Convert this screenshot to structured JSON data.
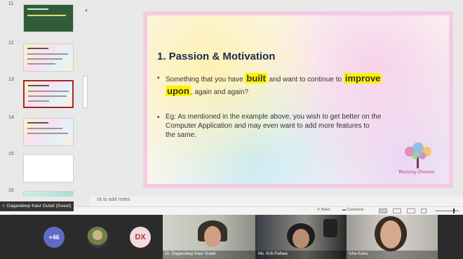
{
  "thumbnails": [
    {
      "number": "11",
      "style": "green"
    },
    {
      "number": "12",
      "style": "pastel"
    },
    {
      "number": "13",
      "style": "selected"
    },
    {
      "number": "14",
      "style": "pastel"
    },
    {
      "number": "15",
      "style": "blank"
    },
    {
      "number": "16",
      "style": "teal"
    }
  ],
  "slide": {
    "title": "1. Passion & Motivation",
    "bullet1": {
      "pre": "Something that you have ",
      "hl1": "built",
      "mid": " and want to continue to ",
      "hl2": "improve",
      "hl3": "upon",
      "post": ", again and again?"
    },
    "bullet2": [
      "Eg: As mentioned in the example above, you wish to get better on the",
      "Computer Application and may even want to add more features to",
      "the same."
    ],
    "logo_text": "Weaving Dreams"
  },
  "notes": {
    "placeholder": "ck to add notes"
  },
  "status": {
    "notes_label": "Notes",
    "comments_label": "Comments"
  },
  "presenter_label": "r. Gagandeep Kaur Gulati (Guest)",
  "meeting": {
    "more_count": "+46",
    "initials": "DX",
    "tiles": [
      {
        "label": "Dr. Gagandeep Kaur Gulati"
      },
      {
        "label": "Ms. Kriti Pahwa"
      },
      {
        "label": "Isha Kalra"
      }
    ]
  },
  "colors": {
    "accent_selected": "#a4262c",
    "highlight": "#fff200",
    "title": "#1c2a52",
    "meeting_bg": "#2b2b2b"
  }
}
